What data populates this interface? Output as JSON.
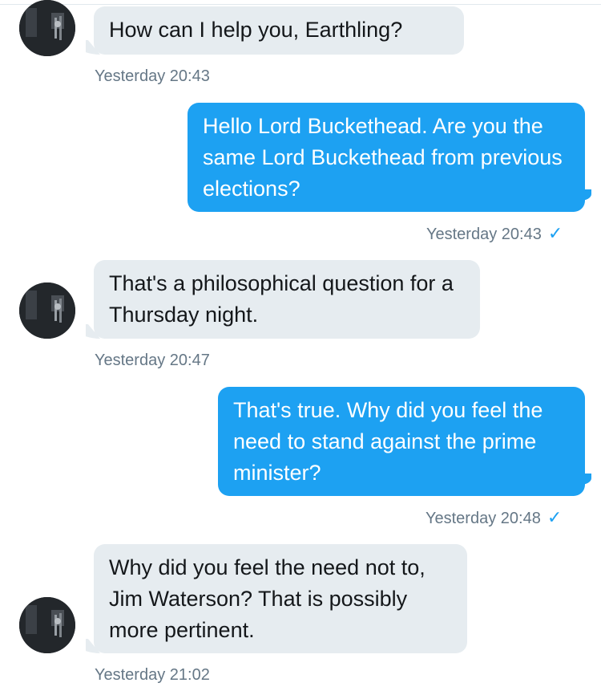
{
  "conversation": {
    "messages": [
      {
        "direction": "incoming",
        "text": "How can I help you, Earthling?",
        "timestamp": "Yesterday 20:43"
      },
      {
        "direction": "outgoing",
        "text": "Hello Lord Buckethead. Are you the same Lord Buckethead from previous elections?",
        "timestamp": "Yesterday 20:43",
        "read_receipt": "✓"
      },
      {
        "direction": "incoming",
        "text": "That's a philosophical question for a Thursday night.",
        "timestamp": "Yesterday 20:47"
      },
      {
        "direction": "outgoing",
        "text": "That's true. Why did you feel the need to stand against the prime minister?",
        "timestamp": "Yesterday 20:48",
        "read_receipt": "✓"
      },
      {
        "direction": "incoming",
        "text": "Why did you feel the need not to, Jim Waterson? That is possibly more pertinent.",
        "timestamp": "Yesterday 21:02"
      }
    ]
  },
  "colors": {
    "incoming_bubble": "#e6ecf0",
    "outgoing_bubble": "#1da1f2",
    "timestamp": "#657786",
    "check": "#1da1f2"
  },
  "icons": {
    "avatar": "avatar-icon",
    "read_receipt": "checkmark-icon"
  }
}
